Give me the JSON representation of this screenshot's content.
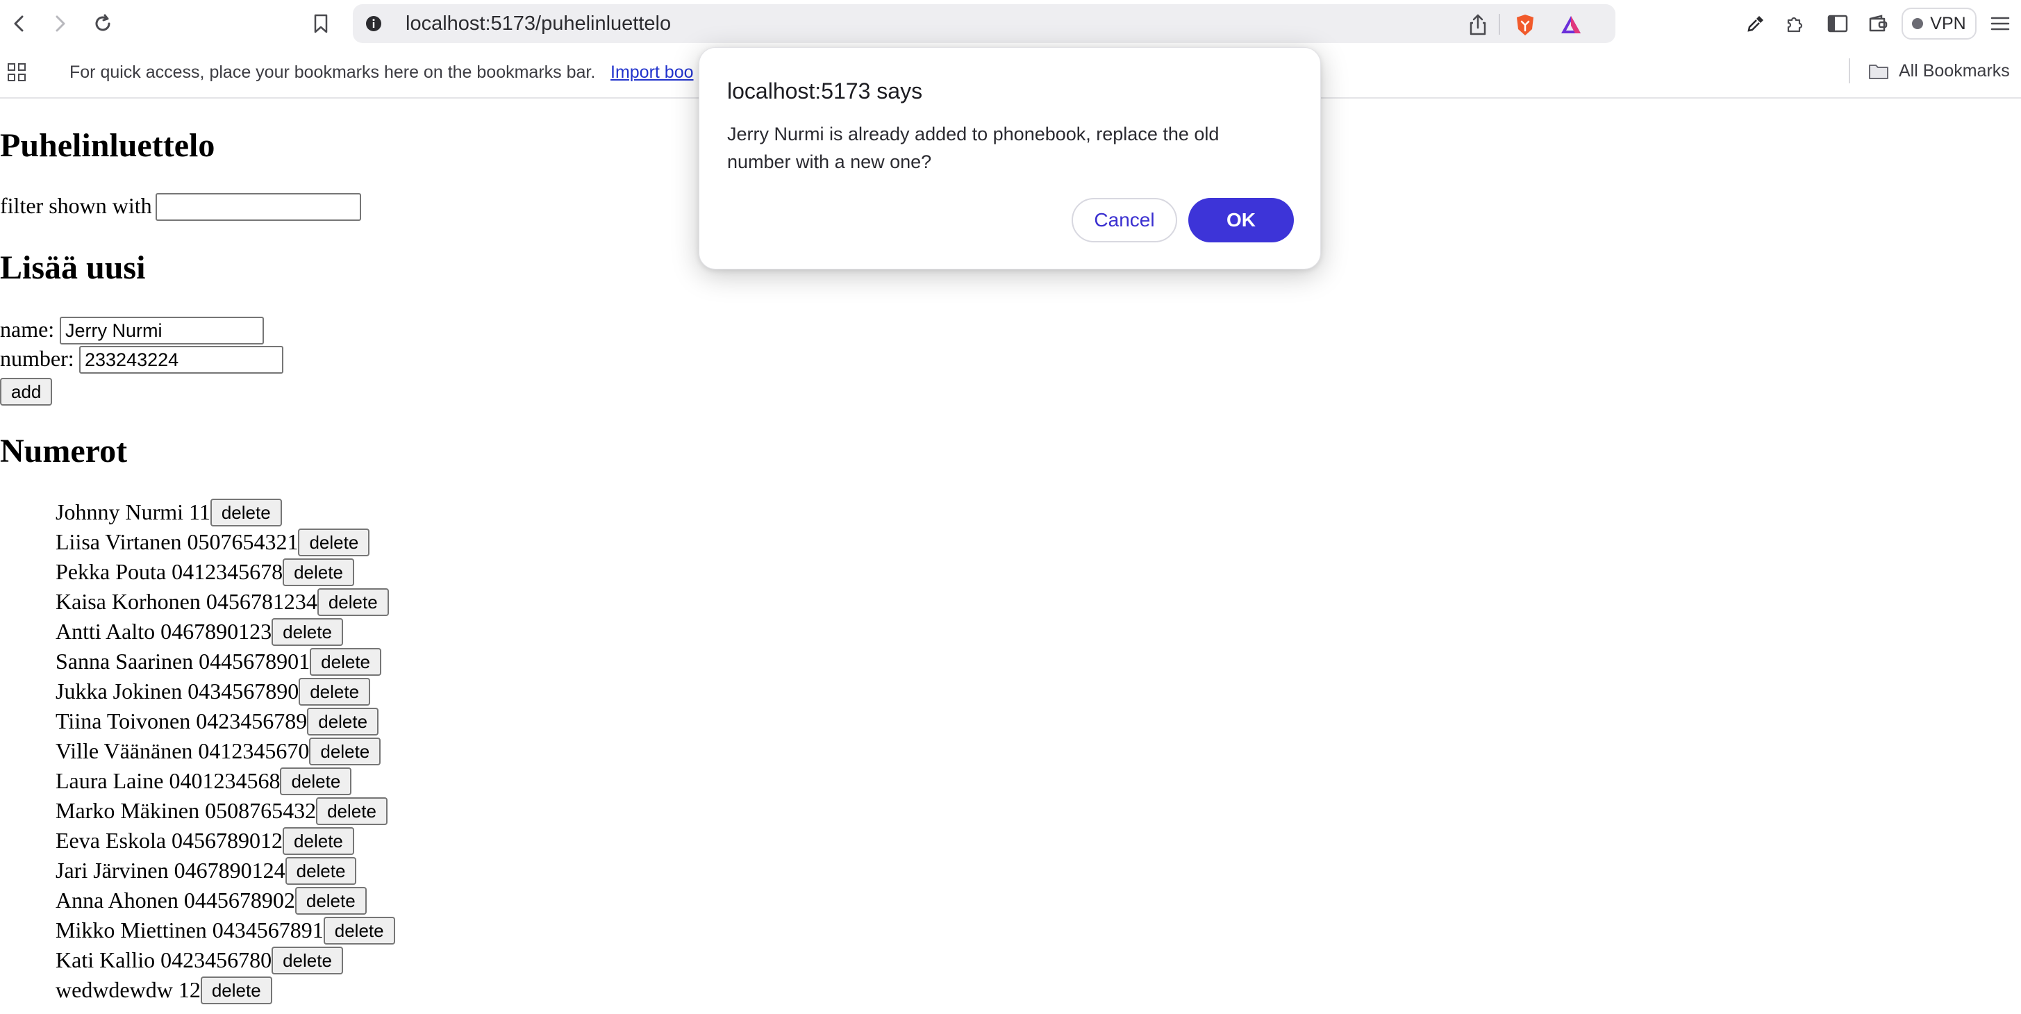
{
  "browser": {
    "url": "localhost:5173/puhelinluettelo",
    "vpn_label": "VPN",
    "bookmarks_hint": "For quick access, place your bookmarks here on the bookmarks bar.",
    "import_link": "Import boo",
    "all_bookmarks": "All Bookmarks"
  },
  "app": {
    "title": "Puhelinluettelo",
    "filter_label": "filter shown with",
    "filter_value": "",
    "add_heading": "Lisää uusi",
    "name_label": "name:",
    "name_value": "Jerry Nurmi",
    "number_label": "number:",
    "number_value": "233243224",
    "add_button": "add",
    "numbers_heading": "Numerot",
    "delete_label": "delete",
    "persons": [
      "Johnny Nurmi 11",
      "Liisa Virtanen 0507654321",
      "Pekka Pouta 0412345678",
      "Kaisa Korhonen 0456781234",
      "Antti Aalto 0467890123",
      "Sanna Saarinen 0445678901",
      "Jukka Jokinen 0434567890",
      "Tiina Toivonen 0423456789",
      "Ville Väänänen 0412345670",
      "Laura Laine 0401234568",
      "Marko Mäkinen 0508765432",
      "Eeva Eskola 0456789012",
      "Jari Järvinen 0467890124",
      "Anna Ahonen 0445678902",
      "Mikko Miettinen 0434567891",
      "Kati Kallio 0423456780",
      "wedwdewdw 12"
    ]
  },
  "dialog": {
    "title": "localhost:5173 says",
    "message": "Jerry Nurmi is already added to phonebook, replace the old number with a new one?",
    "cancel": "Cancel",
    "ok": "OK"
  },
  "colors": {
    "dialog_accent": "#3d34d8",
    "link": "#2233cc"
  }
}
